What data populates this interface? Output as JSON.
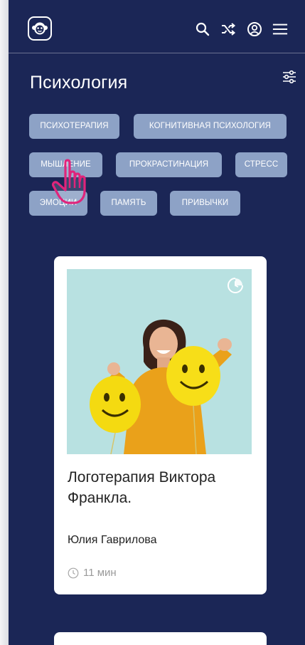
{
  "header": {
    "logo_icon": "monkey-logo-icon",
    "icons": [
      "search-icon",
      "shuffle-icon",
      "profile-icon",
      "menu-icon"
    ]
  },
  "page": {
    "title": "Психология",
    "filter_icon": "filter-sliders-icon"
  },
  "tags": [
    "ПСИХОТЕРАПИЯ",
    "КОГНИТИВНАЯ ПСИХОЛОГИЯ",
    "МЫШЛЕНИЕ",
    "ПРОКРАСТИНАЦИЯ",
    "СТРЕСС",
    "ЭМОЦИИ",
    "ПАМЯТЬ",
    "ПРИВЫЧКИ"
  ],
  "card": {
    "title": "Логотерапия Виктора Франкла.",
    "author": "Юлия Гаврилова",
    "read_time": "11 мин"
  },
  "colors": {
    "background": "#1b2656",
    "chip": "#8da2c6",
    "cursor": "#e0247b"
  }
}
